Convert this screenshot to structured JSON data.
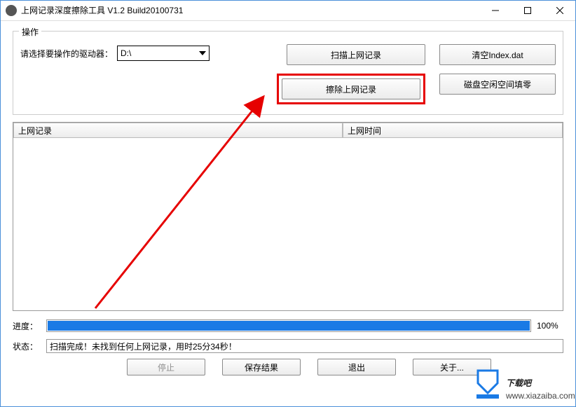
{
  "window": {
    "title": "上网记录深度擦除工具 V1.2   Build20100731"
  },
  "group": {
    "legend": "操作",
    "select_label": "请选择要操作的驱动器：",
    "drive_value": "D:\\",
    "btn_scan": "扫描上网记录",
    "btn_clear_index": "清空Index.dat",
    "btn_erase": "擦除上网记录",
    "btn_fill_zero": "磁盘空闲空间填零"
  },
  "list": {
    "col_record": "上网记录",
    "col_time": "上网时间"
  },
  "progress": {
    "label": "进度：",
    "percent_text": "100%"
  },
  "status": {
    "label": "状态：",
    "text": "扫描完成！未找到任何上网记录，用时25分34秒！"
  },
  "footer": {
    "stop": "停止",
    "save": "保存结果",
    "exit": "退出",
    "about": "关于..."
  },
  "watermark": {
    "brand": "下载吧",
    "url": "www.xiazaiba.com"
  }
}
